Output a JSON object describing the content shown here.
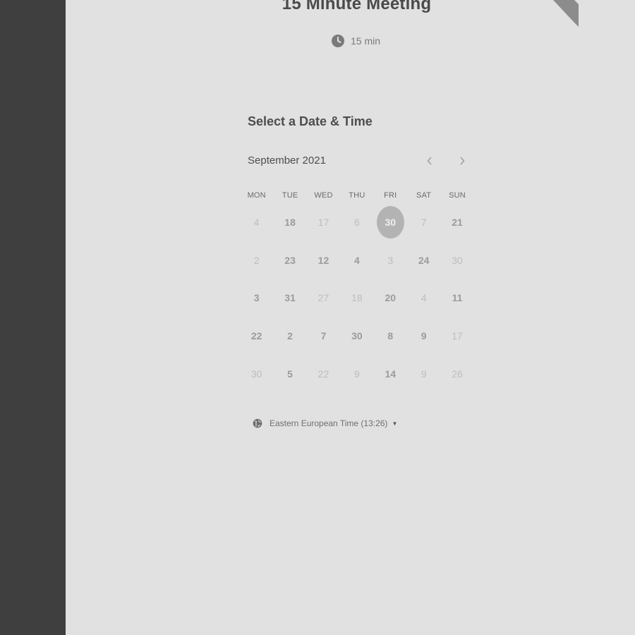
{
  "event": {
    "title": "15 Minute Meeting",
    "duration": "15 min"
  },
  "calendar": {
    "heading": "Select a Date & Time",
    "month_label": "September 2021",
    "weekdays": [
      "MON",
      "TUE",
      "WED",
      "THU",
      "FRI",
      "SAT",
      "SUN"
    ],
    "days": [
      {
        "label": "4",
        "state": "unavailable"
      },
      {
        "label": "18",
        "state": "available"
      },
      {
        "label": "17",
        "state": "unavailable"
      },
      {
        "label": "6",
        "state": "unavailable"
      },
      {
        "label": "30",
        "state": "selected"
      },
      {
        "label": "7",
        "state": "unavailable"
      },
      {
        "label": "21",
        "state": "available"
      },
      {
        "label": "2",
        "state": "unavailable"
      },
      {
        "label": "23",
        "state": "available"
      },
      {
        "label": "12",
        "state": "available"
      },
      {
        "label": "4",
        "state": "available"
      },
      {
        "label": "3",
        "state": "unavailable"
      },
      {
        "label": "24",
        "state": "available"
      },
      {
        "label": "30",
        "state": "unavailable"
      },
      {
        "label": "3",
        "state": "available"
      },
      {
        "label": "31",
        "state": "available"
      },
      {
        "label": "27",
        "state": "unavailable"
      },
      {
        "label": "18",
        "state": "unavailable"
      },
      {
        "label": "20",
        "state": "available"
      },
      {
        "label": "4",
        "state": "unavailable"
      },
      {
        "label": "11",
        "state": "available"
      },
      {
        "label": "22",
        "state": "available"
      },
      {
        "label": "2",
        "state": "available"
      },
      {
        "label": "7",
        "state": "available"
      },
      {
        "label": "30",
        "state": "available"
      },
      {
        "label": "8",
        "state": "available"
      },
      {
        "label": "9",
        "state": "available"
      },
      {
        "label": "17",
        "state": "unavailable"
      },
      {
        "label": "30",
        "state": "unavailable"
      },
      {
        "label": "5",
        "state": "available"
      },
      {
        "label": "22",
        "state": "unavailable"
      },
      {
        "label": "9",
        "state": "unavailable"
      },
      {
        "label": "14",
        "state": "available"
      },
      {
        "label": "9",
        "state": "unavailable"
      },
      {
        "label": "26",
        "state": "unavailable"
      }
    ]
  },
  "timezone": {
    "label": "Eastern European Time (13:26)"
  },
  "icons": {
    "duration": "clock-icon",
    "timezone": "globe-icon",
    "prev": "chevron-left-icon",
    "next": "chevron-right-icon",
    "timezone_toggle": "caret-down-icon"
  },
  "colors": {
    "sidebar": "#3f3f3f",
    "background": "#e1e1e1",
    "selected_day": "#b3b3b3",
    "ribbon": "#8c8c8c"
  }
}
